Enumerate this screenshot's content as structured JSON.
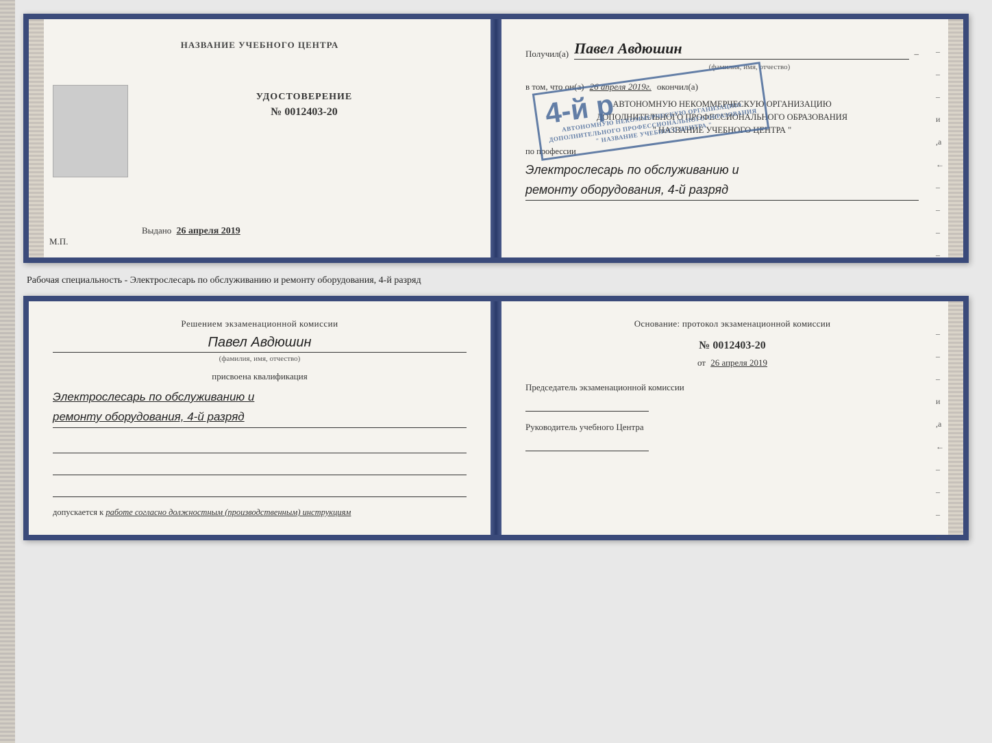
{
  "top_booklet": {
    "left": {
      "title": "НАЗВАНИЕ УЧЕБНОГО ЦЕНТРА",
      "cert_label": "УДОСТОВЕРЕНИЕ",
      "cert_number": "№ 0012403-20",
      "issued_label": "Выдано",
      "issued_date": "26 апреля 2019",
      "mp_label": "М.П."
    },
    "right": {
      "recipient_label": "Получил(а)",
      "recipient_name": "Павел Авдюшин",
      "fio_subtitle": "(фамилия, имя, отчество)",
      "vtom_label": "в том, что он(а)",
      "completed_date": "26 апреля 2019г.",
      "okончил_label": "окончил(а)",
      "org_line1": "АВТОНОМНУЮ НЕКОММЕРЧЕСКУЮ ОРГАНИЗАЦИЮ",
      "org_line2": "ДОПОЛНИТЕЛЬНОГО ПРОФЕССИОНАЛЬНОГО ОБРАЗОВАНИЯ",
      "org_name": "\" НАЗВАНИЕ УЧЕБНОГО ЦЕНТРА \"",
      "profession_label": "по профессии",
      "profession_line1": "Электрослесарь по обслуживанию и",
      "profession_line2": "ремонту оборудования, 4-й разряд",
      "stamp_big": "4-й р",
      "dash_items": [
        "–",
        "–",
        "–",
        "и",
        ",а",
        "←",
        "–",
        "–",
        "–",
        "–"
      ]
    }
  },
  "between": {
    "text": "Рабочая специальность - Электрослесарь по обслуживанию и ремонту оборудования, 4-й разряд"
  },
  "bottom_booklet": {
    "left": {
      "decision_title": "Решением экзаменационной комиссии",
      "person_name": "Павел Авдюшин",
      "fio_subtitle": "(фамилия, имя, отчество)",
      "assigned_label": "присвоена квалификация",
      "qualification_line1": "Электрослесарь по обслуживанию и",
      "qualification_line2": "ремонту оборудования, 4-й разряд",
      "допускается_label": "допускается к",
      "допускается_value": "работе согласно должностным (производственным) инструкциям"
    },
    "right": {
      "osnov_label": "Основание: протокол экзаменационной комиссии",
      "protocol_number": "№ 0012403-20",
      "protocol_date_label": "от",
      "protocol_date": "26 апреля 2019",
      "chairman_label": "Председатель экзаменационной комиссии",
      "head_label": "Руководитель учебного Центра",
      "dash_items": [
        "–",
        "–",
        "–",
        "и",
        ",а",
        "←",
        "–",
        "–",
        "–",
        "–"
      ]
    }
  }
}
